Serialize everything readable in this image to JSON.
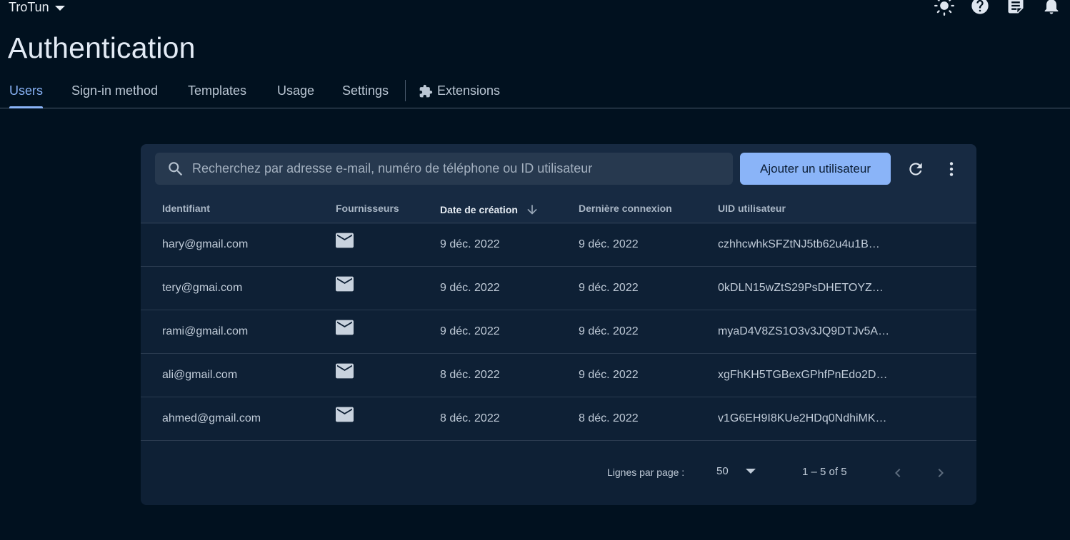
{
  "header": {
    "project_name": "TroTun",
    "icons": [
      "theme-toggle-icon",
      "help-icon",
      "notes-icon",
      "notifications-icon"
    ]
  },
  "page": {
    "title": "Authentication"
  },
  "tabs": [
    {
      "label": "Users",
      "active": true
    },
    {
      "label": "Sign-in method"
    },
    {
      "label": "Templates"
    },
    {
      "label": "Usage"
    },
    {
      "label": "Settings"
    },
    {
      "label": "Extensions",
      "icon": "extension-icon"
    }
  ],
  "users_panel": {
    "search_placeholder": "Recherchez par adresse e-mail, numéro de téléphone ou ID utilisateur",
    "add_user_label": "Ajouter un utilisateur",
    "columns": {
      "identifier": "Identifiant",
      "providers": "Fournisseurs",
      "created": "Date de création",
      "last_sign_in": "Dernière connexion",
      "uid": "UID utilisateur"
    },
    "rows": [
      {
        "email": "hary@gmail.com",
        "provider": "email",
        "created": "9 déc. 2022",
        "last": "9 déc. 2022",
        "uid": "czhhcwhkSFZtNJ5tb62u4u1B…"
      },
      {
        "email": "tery@gmai.com",
        "provider": "email",
        "created": "9 déc. 2022",
        "last": "9 déc. 2022",
        "uid": "0kDLN15wZtS29PsDHETOYZ…"
      },
      {
        "email": "rami@gmail.com",
        "provider": "email",
        "created": "9 déc. 2022",
        "last": "9 déc. 2022",
        "uid": "myaD4V8ZS1O3v3JQ9DTJv5A…"
      },
      {
        "email": "ali@gmail.com",
        "provider": "email",
        "created": "8 déc. 2022",
        "last": "9 déc. 2022",
        "uid": "xgFhKH5TGBexGPhfPnEdo2D…"
      },
      {
        "email": "ahmed@gmail.com",
        "provider": "email",
        "created": "8 déc. 2022",
        "last": "8 déc. 2022",
        "uid": "v1G6EH9I8KUe2HDq0NdhiMK…"
      }
    ],
    "pagination": {
      "rows_per_page_label": "Lignes par page :",
      "rows_per_page": "50",
      "range": "1 – 5 of 5"
    }
  },
  "colors": {
    "background": "#01111f",
    "card": "#0e2035",
    "accent": "#8ab4f8"
  }
}
